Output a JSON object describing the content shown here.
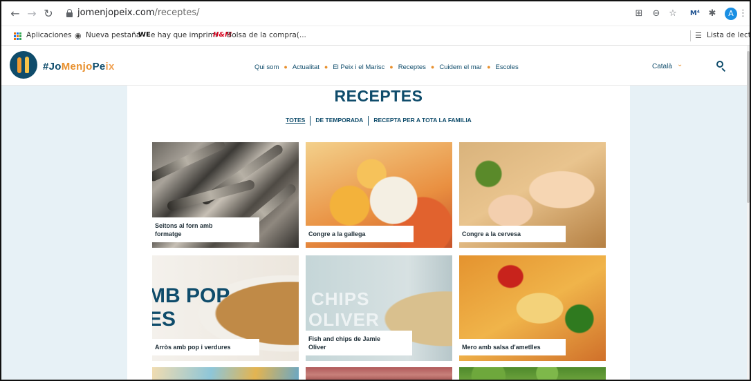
{
  "browser": {
    "url_host": "jomenjopeix.com",
    "url_path": "/receptes/",
    "avatar_letter": "A",
    "bookmarks": {
      "apps": "Aplicaciones",
      "new_tab": "Nueva pestaña",
      "print": "e hay que imprimi",
      "bag": "Bolsa de la compra(...",
      "reading_list": "Lista de lectura",
      "hm_logo": "H&M",
      "we_logo": "WE"
    },
    "icons": [
      "back-arrow-icon",
      "forward-arrow-icon",
      "reload-icon",
      "lock-icon",
      "translate-icon",
      "zoom-icon",
      "star-icon",
      "extension-icon",
      "puzzle-icon",
      "menu-icon"
    ]
  },
  "site": {
    "logo_parts": [
      "#Jo",
      "Menjo",
      "Pe",
      "ix"
    ],
    "nav": [
      "Qui som",
      "Actualitat",
      "El Peix i el Marisc",
      "Receptes",
      "Cuidem el mar",
      "Escoles"
    ],
    "language": "Català",
    "colors": {
      "primary": "#0f4c6b",
      "accent": "#e8902e",
      "background": "#e7f1f6"
    }
  },
  "page": {
    "title": "RECEPTES",
    "filters": [
      "TOTES",
      "DE TEMPORADA",
      "RECEPTA PER A TOTA LA FAMILIA"
    ],
    "active_filter": "TOTES"
  },
  "recipes": [
    {
      "title_lines": [
        "Seitons al forn amb",
        "formatge"
      ]
    },
    {
      "title_lines": [
        "Congre a la gallega"
      ]
    },
    {
      "title_lines": [
        "Congre a la cervesa"
      ]
    },
    {
      "title_lines": [
        "Arròs amb pop i verdures"
      ],
      "overlay": [
        "MB POP",
        "ES"
      ]
    },
    {
      "title_lines": [
        "Fish and chips de Jamie",
        "Oliver"
      ],
      "overlay": [
        "CHIPS",
        "OLIVER"
      ]
    },
    {
      "title_lines": [
        "Mero amb salsa d'ametlles"
      ]
    }
  ]
}
